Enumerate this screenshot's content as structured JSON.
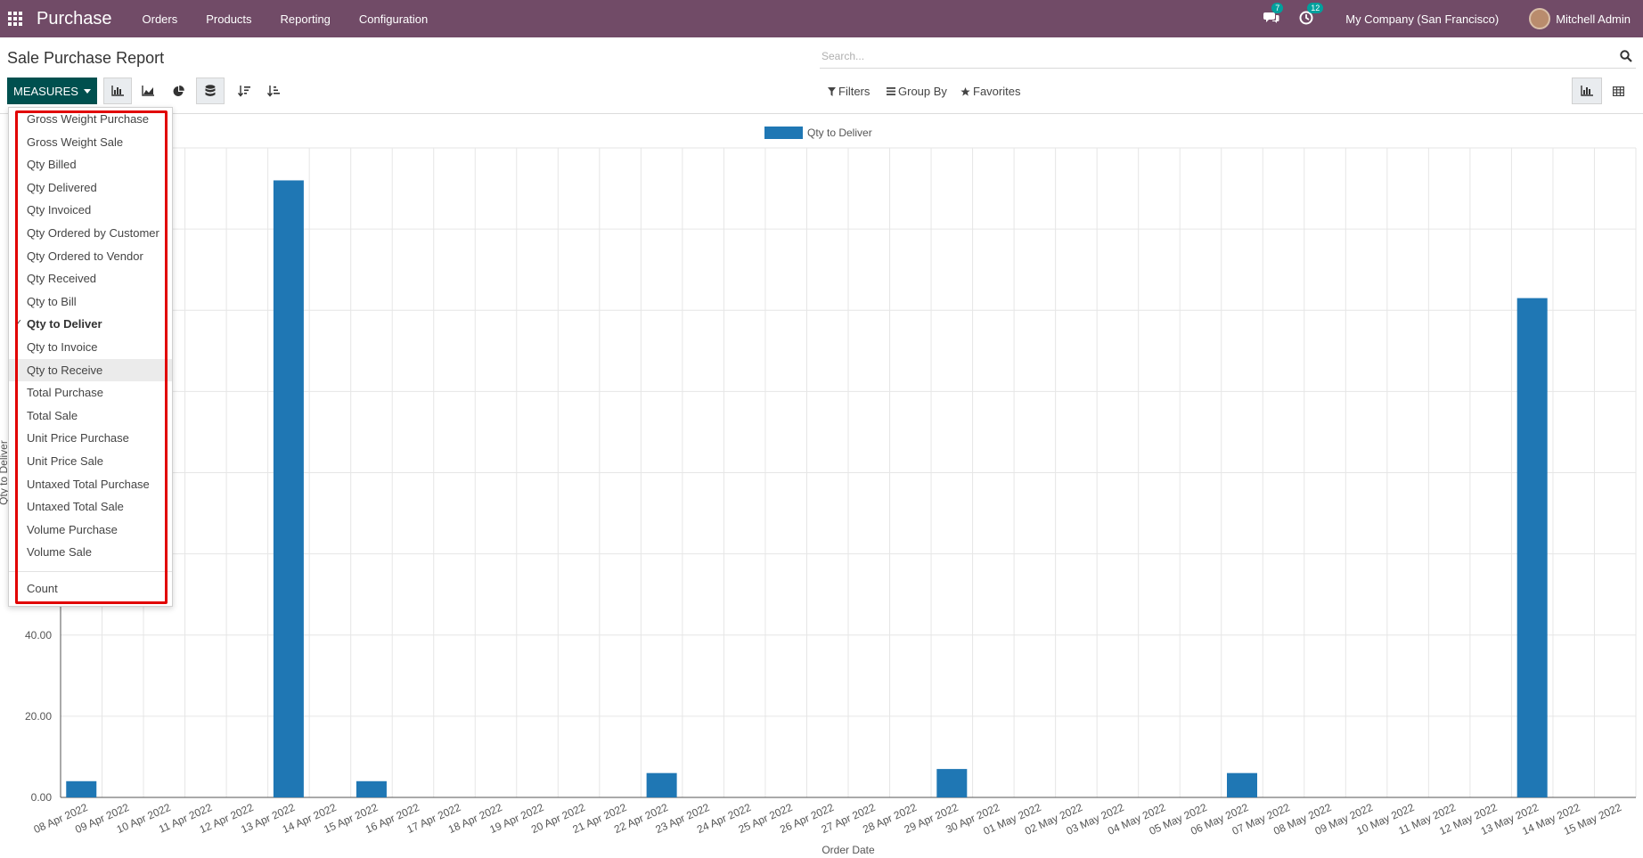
{
  "navbar": {
    "app_name": "Purchase",
    "menu": [
      "Orders",
      "Products",
      "Reporting",
      "Configuration"
    ],
    "messages_count": "7",
    "activities_count": "12",
    "company": "My Company (San Francisco)",
    "user": "Mitchell Admin"
  },
  "page": {
    "title": "Sale Purchase Report"
  },
  "search": {
    "placeholder": "Search..."
  },
  "toolbar": {
    "measures_label": "MEASURES",
    "filters_label": "Filters",
    "group_by_label": "Group By",
    "favorites_label": "Favorites"
  },
  "measures_menu": {
    "items": [
      {
        "label": "Gross Weight Purchase",
        "checked": false
      },
      {
        "label": "Gross Weight Sale",
        "checked": false
      },
      {
        "label": "Qty Billed",
        "checked": false
      },
      {
        "label": "Qty Delivered",
        "checked": false
      },
      {
        "label": "Qty Invoiced",
        "checked": false
      },
      {
        "label": "Qty Ordered by Customer",
        "checked": false
      },
      {
        "label": "Qty Ordered to Vendor",
        "checked": false
      },
      {
        "label": "Qty Received",
        "checked": false
      },
      {
        "label": "Qty to Bill",
        "checked": false
      },
      {
        "label": "Qty to Deliver",
        "checked": true
      },
      {
        "label": "Qty to Invoice",
        "checked": false
      },
      {
        "label": "Qty to Receive",
        "checked": false,
        "hover": true
      },
      {
        "label": "Total Purchase",
        "checked": false
      },
      {
        "label": "Total Sale",
        "checked": false
      },
      {
        "label": "Unit Price Purchase",
        "checked": false
      },
      {
        "label": "Unit Price Sale",
        "checked": false
      },
      {
        "label": "Untaxed Total Purchase",
        "checked": false
      },
      {
        "label": "Untaxed Total Sale",
        "checked": false
      },
      {
        "label": "Volume Purchase",
        "checked": false
      },
      {
        "label": "Volume Sale",
        "checked": false
      }
    ],
    "count_label": "Count"
  },
  "chart_data": {
    "type": "bar",
    "title": "",
    "xlabel": "Order Date",
    "ylabel": "Qty to Deliver",
    "legend": "top-center",
    "grid": true,
    "ylim": [
      0,
      160
    ],
    "yticks": [
      "0.00",
      "20.00",
      "40.00"
    ],
    "series_color": "#1f77b4",
    "categories": [
      "08 Apr 2022",
      "09 Apr 2022",
      "10 Apr 2022",
      "11 Apr 2022",
      "12 Apr 2022",
      "13 Apr 2022",
      "14 Apr 2022",
      "15 Apr 2022",
      "16 Apr 2022",
      "17 Apr 2022",
      "18 Apr 2022",
      "19 Apr 2022",
      "20 Apr 2022",
      "21 Apr 2022",
      "22 Apr 2022",
      "23 Apr 2022",
      "24 Apr 2022",
      "25 Apr 2022",
      "26 Apr 2022",
      "27 Apr 2022",
      "28 Apr 2022",
      "29 Apr 2022",
      "30 Apr 2022",
      "01 May 2022",
      "02 May 2022",
      "03 May 2022",
      "04 May 2022",
      "05 May 2022",
      "06 May 2022",
      "07 May 2022",
      "08 May 2022",
      "09 May 2022",
      "10 May 2022",
      "11 May 2022",
      "12 May 2022",
      "13 May 2022",
      "14 May 2022",
      "15 May 2022"
    ],
    "series": [
      {
        "name": "Qty to Deliver",
        "values": [
          4,
          0,
          0,
          0,
          0,
          152,
          0,
          4,
          0,
          0,
          0,
          0,
          0,
          0,
          6,
          0,
          0,
          0,
          0,
          0,
          0,
          7,
          0,
          0,
          0,
          0,
          0,
          0,
          6,
          0,
          0,
          0,
          0,
          0,
          0,
          123,
          0,
          0
        ]
      }
    ]
  }
}
